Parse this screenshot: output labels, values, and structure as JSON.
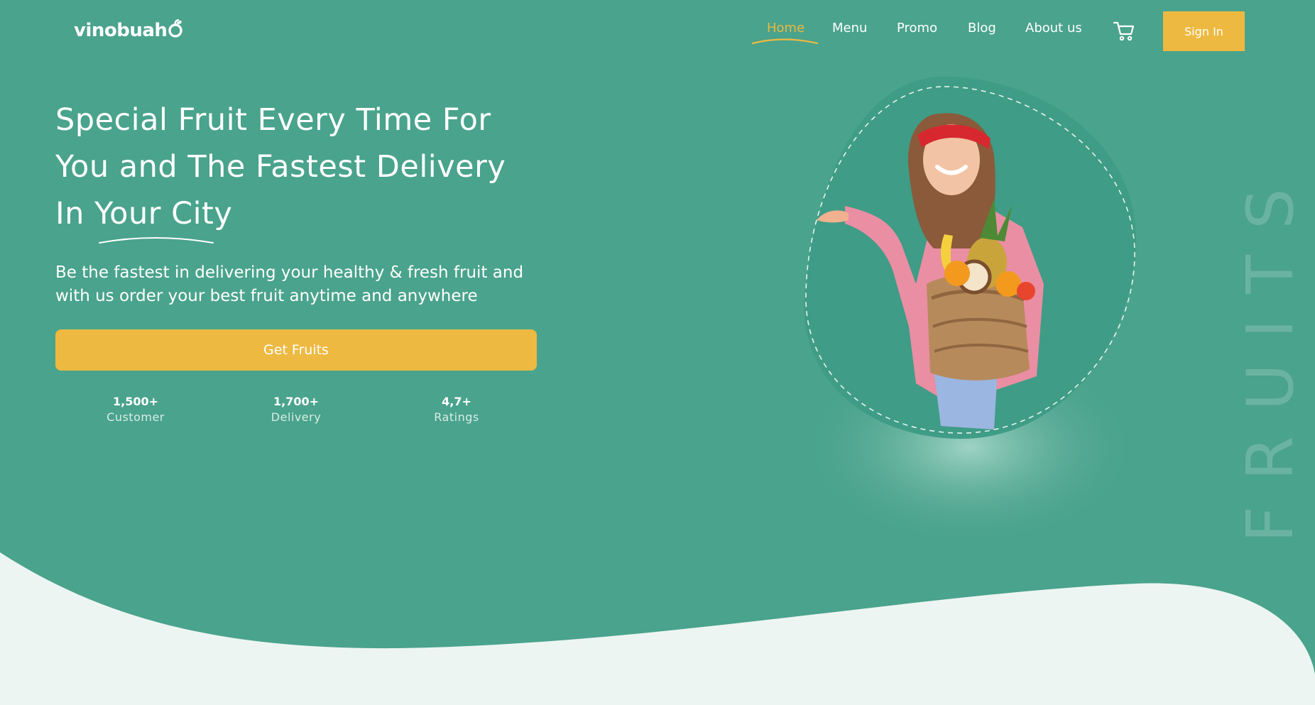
{
  "brand": {
    "name": "vinobuah",
    "accent_color": "#edb941",
    "background_color": "#4aa38c",
    "surface_color": "#edf5f3"
  },
  "nav": {
    "items": [
      {
        "label": "Home",
        "active": true
      },
      {
        "label": "Menu",
        "active": false
      },
      {
        "label": "Promo",
        "active": false
      },
      {
        "label": "Blog",
        "active": false
      },
      {
        "label": "About us",
        "active": false
      }
    ],
    "cart_icon": "shopping-cart-icon",
    "signin_label": "Sign In"
  },
  "hero": {
    "headline_line1": "Special Fruit Every Time For",
    "headline_line2": "You and The Fastest Delivery",
    "headline_line3": "In Your City",
    "subtitle_line1": "Be the fastest in delivering your healthy & fresh fruit and",
    "subtitle_line2": "with us order your best fruit anytime and anywhere",
    "cta_label": "Get Fruits",
    "stats": [
      {
        "value": "1,500+",
        "label": "Customer"
      },
      {
        "value": "1,700+",
        "label": "Delivery"
      },
      {
        "value": "4,7+",
        "label": "Ratings"
      }
    ],
    "image_subject": "woman holding a basket of fruits",
    "vertical_word": "FRUITS"
  }
}
